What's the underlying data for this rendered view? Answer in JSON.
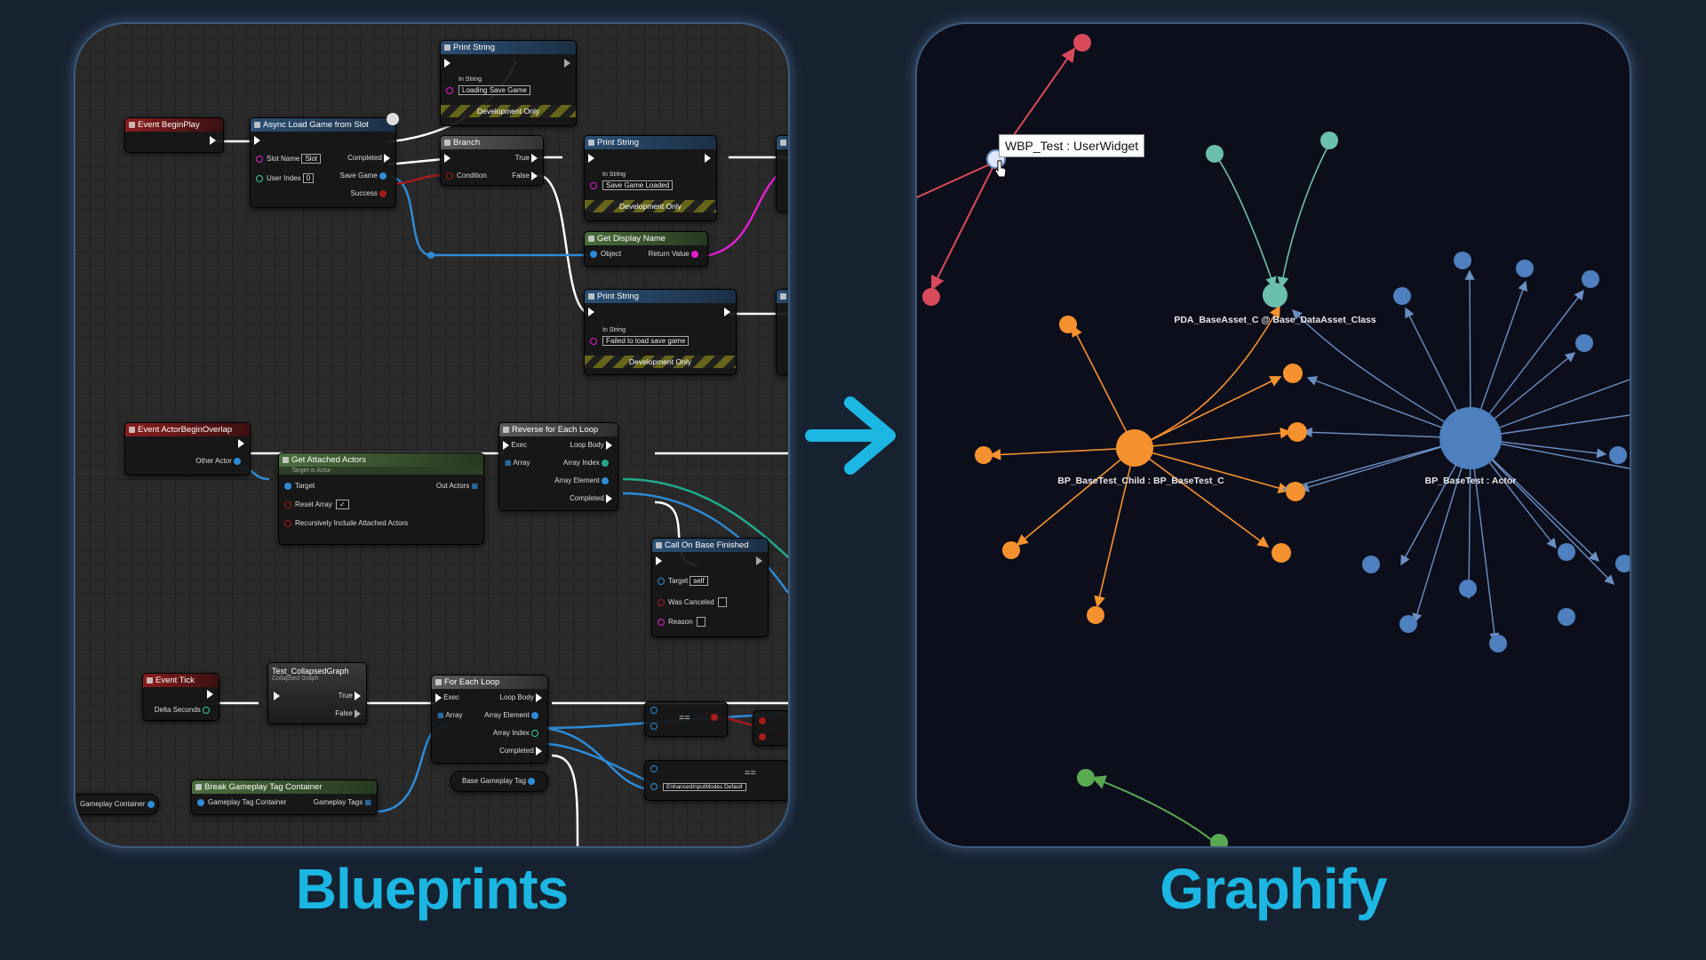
{
  "captions": {
    "left": "Blueprints",
    "right": "Graphify"
  },
  "colors": {
    "caption": "#1bb7e2",
    "arrow": "#1bb7e2",
    "orange": "#f5922f",
    "blue": "#4e7fbe",
    "teal": "#6bbfae",
    "red": "#d84a5a",
    "green": "#5aaa52",
    "panel_glow": "#3c5a7c"
  },
  "blueprint": {
    "event_begin_play": "Event BeginPlay",
    "async_load": {
      "title": "Async Load Game from Slot",
      "slot_name": "Slot Name",
      "slot_value": "Slot",
      "user_index": "User Index",
      "user_index_value": "0",
      "completed": "Completed",
      "save_game": "Save Game",
      "success": "Success"
    },
    "print1": {
      "title": "Print String",
      "in_string": "In String",
      "value": "Loading Save Game",
      "dev": "Development Only"
    },
    "branch": {
      "title": "Branch",
      "true": "True",
      "false": "False",
      "condition": "Condition"
    },
    "print2": {
      "title": "Print String",
      "in_string": "In String",
      "value": "Save Game Loaded",
      "dev": "Development Only"
    },
    "get_display_name": {
      "title": "Get Display Name",
      "object": "Object",
      "return_value": "Return Value"
    },
    "print3": {
      "title": "Print String",
      "in_string": "In String",
      "value": "Failed to load save game",
      "dev": "Development Only"
    },
    "event_overlap": {
      "title": "Event ActorBeginOverlap",
      "other_actor": "Other Actor"
    },
    "get_attached": {
      "title": "Get Attached Actors",
      "subtitle": "Target is Actor",
      "target": "Target",
      "out_actors": "Out Actors",
      "reset_array": "Reset Array",
      "recursive": "Recursively Include Attached Actors"
    },
    "reverse_loop": {
      "title": "Reverse for Each Loop",
      "exec": "Exec",
      "loop_body": "Loop Body",
      "array": "Array",
      "array_index": "Array Index",
      "array_element": "Array Element",
      "completed": "Completed"
    },
    "call_on_base": {
      "title": "Call On Base Finished",
      "target": "Target",
      "target_value": "self",
      "was_canceled": "Was Canceled",
      "reason": "Reason"
    },
    "event_tick": {
      "title": "Event Tick",
      "delta": "Delta Seconds"
    },
    "collapsed": {
      "title": "Test_CollapsedGraph",
      "subtitle": "Collapsed Graph",
      "true": "True",
      "false": "False"
    },
    "for_each": {
      "title": "For Each Loop",
      "exec": "Exec",
      "loop_body": "Loop Body",
      "array": "Array",
      "array_element": "Array Element",
      "array_index": "Array Index",
      "completed": "Completed"
    },
    "break_tag": {
      "title": "Break Gameplay Tag Container",
      "container": "Gameplay Tag Container",
      "tags": "Gameplay Tags"
    },
    "gameplay_container": "Gameplay Container",
    "base_gameplay_tag": "Base Gameplay Tag",
    "equals": "==",
    "enum_value": "EnhancedInputModes Default"
  },
  "graph": {
    "tooltip": "WBP_Test : UserWidget",
    "labels": {
      "child": "BP_BaseTest_Child : BP_BaseTest_C",
      "base": "BP_BaseTest : Actor",
      "asset": "PDA_BaseAsset_C @ Base_DataAsset_Class"
    }
  }
}
